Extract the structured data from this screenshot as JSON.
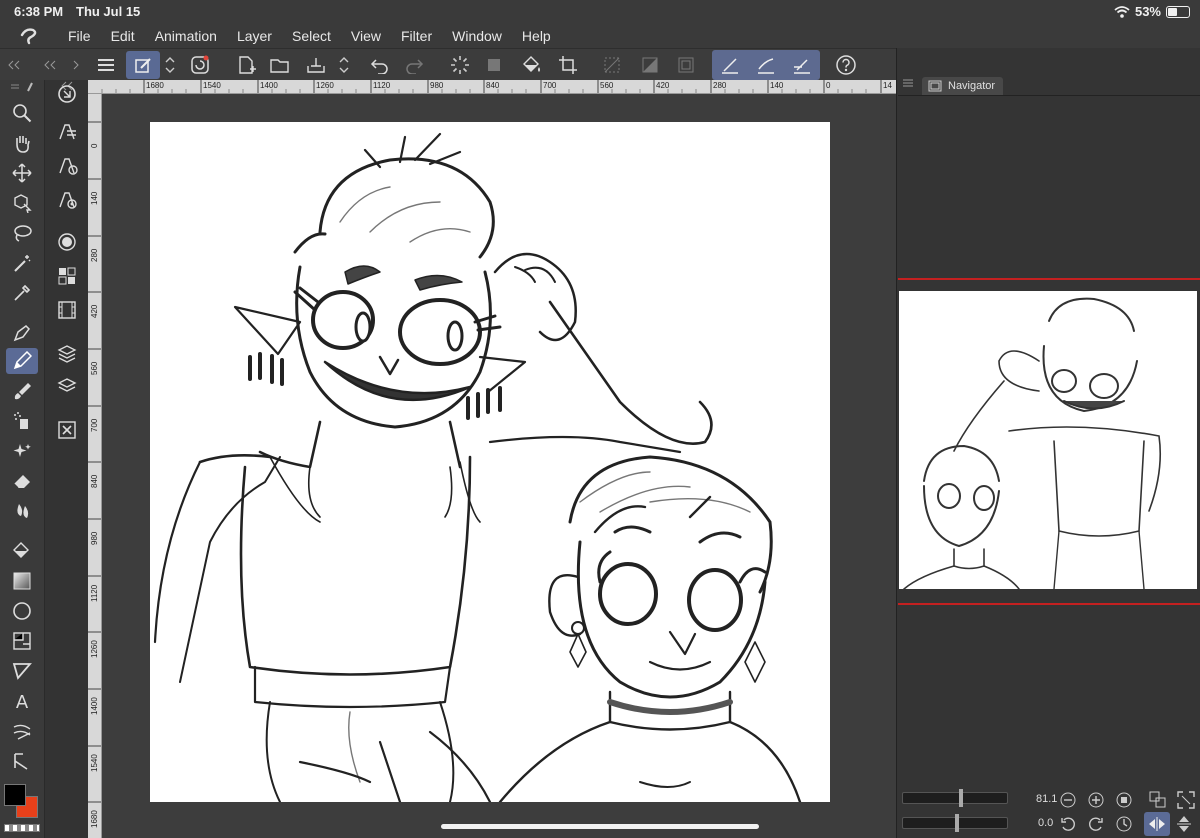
{
  "status": {
    "time": "6:38 PM",
    "date": "Thu Jul 15",
    "battery": "53%"
  },
  "menu": [
    "File",
    "Edit",
    "Animation",
    "Layer",
    "Select",
    "View",
    "Filter",
    "Window",
    "Help"
  ],
  "ruler": {
    "h": [
      "1680",
      "1540",
      "1400",
      "1260",
      "1120",
      "980",
      "840",
      "700",
      "560",
      "420",
      "280",
      "140",
      "0",
      "14"
    ],
    "v": [
      "0",
      "140",
      "280",
      "420",
      "560",
      "700",
      "840",
      "980",
      "1120",
      "1260",
      "1400",
      "1540",
      "1680"
    ]
  },
  "navigator": {
    "tab_label": "Navigator",
    "zoom": "81.1",
    "rotation": "0.0"
  },
  "colors": {
    "main": "#000000",
    "sub": "#e8401a",
    "accent": "#5b6b96",
    "navigator_frame": "#c42020"
  }
}
